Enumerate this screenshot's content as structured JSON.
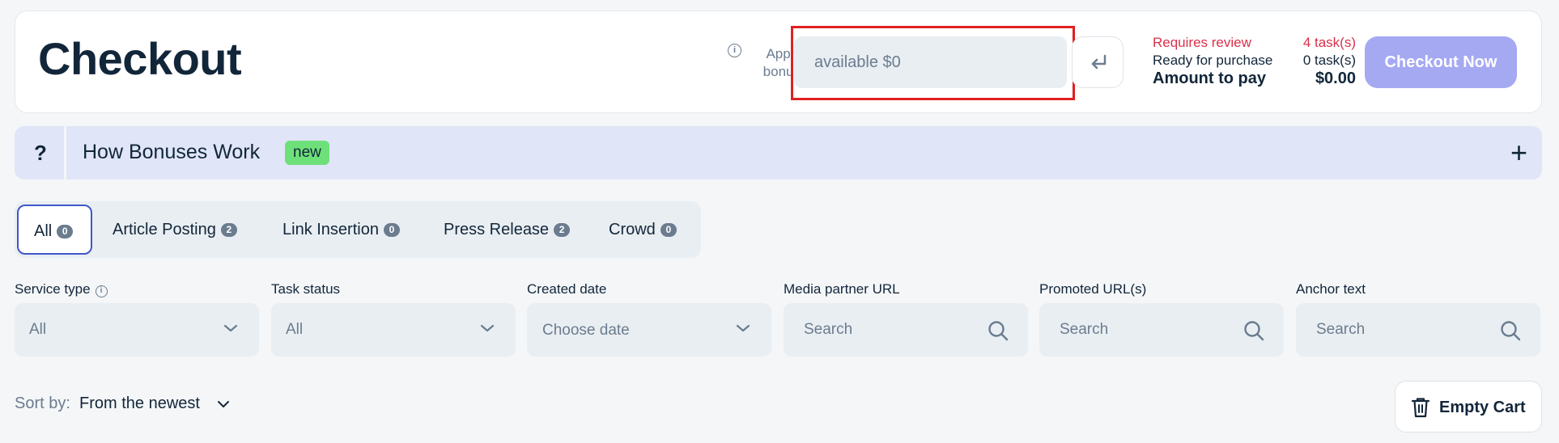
{
  "header": {
    "title": "Checkout",
    "bonus_label": "Apply bonus",
    "bonus_placeholder": "available $0",
    "summary": {
      "review_label": "Requires review",
      "review_value": "4 task(s)",
      "ready_label": "Ready for purchase",
      "ready_value": "0 task(s)",
      "amount_label": "Amount to pay",
      "amount_value": "$0.00"
    },
    "checkout_button": "Checkout Now"
  },
  "banner": {
    "help": "?",
    "title": "How Bonuses Work",
    "badge": "new",
    "expand": "+"
  },
  "tabs": [
    {
      "label": "All",
      "count": "0",
      "active": true
    },
    {
      "label": "Article Posting",
      "count": "2"
    },
    {
      "label": "Link Insertion",
      "count": "0"
    },
    {
      "label": "Press Release",
      "count": "2"
    },
    {
      "label": "Crowd",
      "count": "0"
    }
  ],
  "filters": {
    "service_type": {
      "label": "Service type",
      "value": "All"
    },
    "task_status": {
      "label": "Task status",
      "value": "All"
    },
    "created_date": {
      "label": "Created date",
      "value": "Choose date"
    },
    "media_partner_url": {
      "label": "Media partner URL",
      "placeholder": "Search"
    },
    "promoted_urls": {
      "label": "Promoted URL(s)",
      "placeholder": "Search"
    },
    "anchor_text": {
      "label": "Anchor text",
      "placeholder": "Search"
    }
  },
  "sort": {
    "label": "Sort by:",
    "value": "From the newest"
  },
  "empty_cart": "Empty Cart",
  "colors": {
    "accent": "#4057c9",
    "checkout": "#a5a9f2",
    "review": "#d9304b",
    "badge_new": "#6ee07a",
    "highlight": "#e02020"
  }
}
